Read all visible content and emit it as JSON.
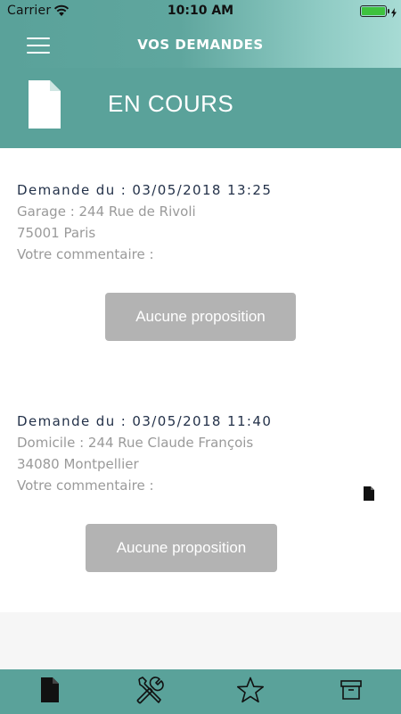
{
  "status_bar": {
    "carrier": "Carrier",
    "time": "10:10 AM",
    "battery_level": 1.0
  },
  "nav": {
    "title": "VOS DEMANDES",
    "menu_icon": "hamburger-icon"
  },
  "section": {
    "title": "EN COURS",
    "icon": "document-icon"
  },
  "requests": [
    {
      "header": "Demande du : 03/05/2018 13:25",
      "location": "Garage : 244 Rue de Rivoli",
      "city": "75001 Paris",
      "comment_label": "Votre commentaire :",
      "button_label": "Aucune proposition"
    },
    {
      "header": "Demande du : 03/05/2018 11:40",
      "location": "Domicile : 244 Rue Claude François",
      "city": "34080 Montpellier",
      "comment_label": "Votre commentaire :",
      "button_label": "Aucune proposition",
      "attachment_icon": "document-icon"
    }
  ],
  "tabs": [
    {
      "icon": "document-icon",
      "active": true
    },
    {
      "icon": "tools-icon",
      "active": false
    },
    {
      "icon": "star-icon",
      "active": false
    },
    {
      "icon": "archive-icon",
      "active": false
    }
  ],
  "colors": {
    "teal": "#5aa29a",
    "button_gray": "#b3b3b3",
    "header_text": "#24324a",
    "detail_text": "#9a9a9a"
  }
}
